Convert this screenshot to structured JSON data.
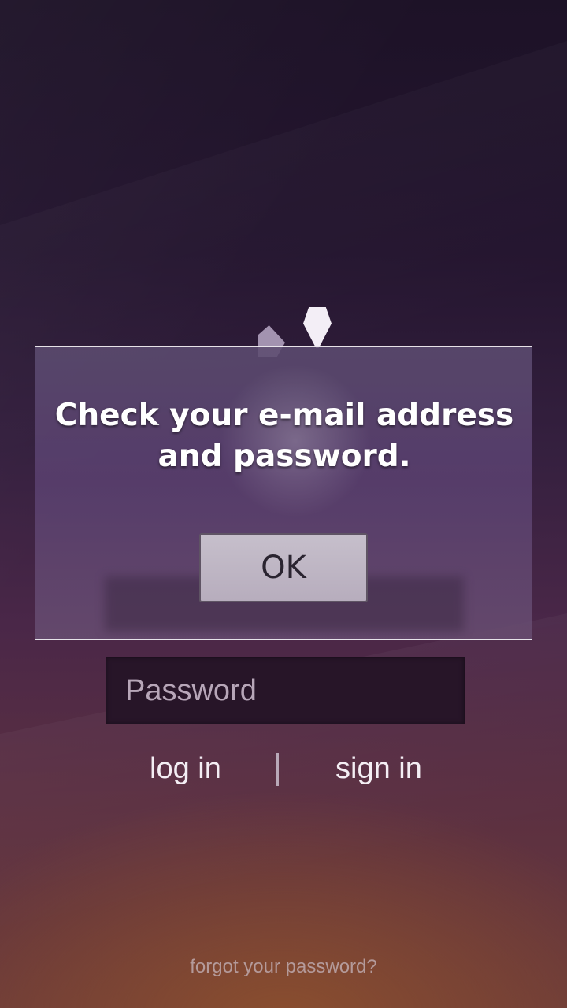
{
  "login_form": {
    "password_placeholder": "Password",
    "password_value": "",
    "login_label": "log in",
    "signin_label": "sign in",
    "forgot_label": "forgot your password?"
  },
  "dialog": {
    "message_line1": "Check your e-mail address",
    "message_line2": "and password.",
    "ok_label": "OK"
  },
  "colors": {
    "background_top": "#1d1227",
    "background_bottom": "#8a4e2e",
    "field_background": "#271528",
    "dialog_background": "#5c4c70",
    "button_background": "#c6bfcb"
  }
}
